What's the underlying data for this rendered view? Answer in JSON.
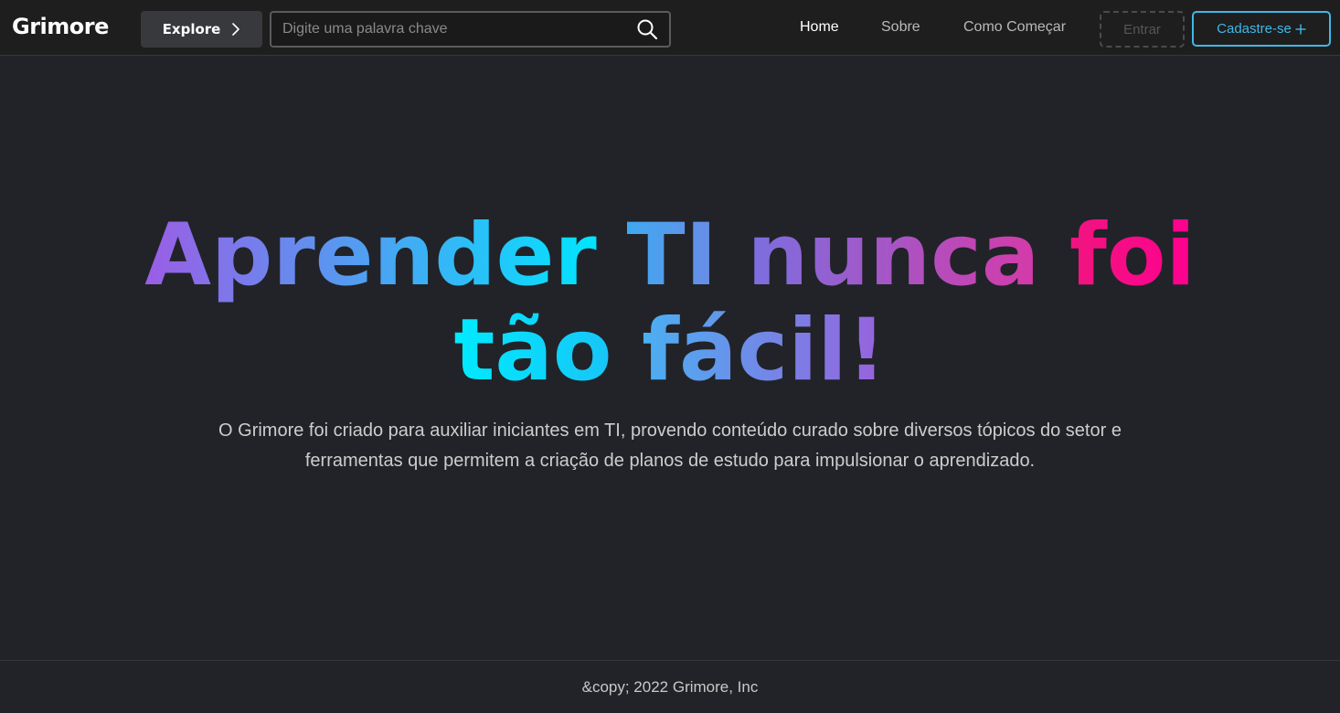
{
  "header": {
    "logo": "Grimore",
    "explore_label": "Explore",
    "search_placeholder": "Digite uma palavra chave",
    "nav": [
      {
        "label": "Home",
        "active": true
      },
      {
        "label": "Sobre",
        "active": false
      },
      {
        "label": "Como Começar",
        "active": false
      }
    ],
    "login_label": "Entrar",
    "signup_label": "Cadastre-se"
  },
  "hero": {
    "title_line1": [
      "Aprender",
      "TI",
      "nunca",
      "foi"
    ],
    "title_line2": [
      "tão",
      "fácil!"
    ],
    "description": "O Grimore foi criado para auxiliar iniciantes em TI, provendo conteúdo curado sobre diversos tópicos do setor e ferramentas que permitem a criação de planos de estudo para impulsionar o aprendizado."
  },
  "footer": {
    "text": "&copy; 2022 Grimore, Inc"
  },
  "colors": {
    "background": "#212328",
    "navbar": "#1e1e1e",
    "accent": "#3fb8e8",
    "gradient_purple": "#9b5de5",
    "gradient_cyan": "#00e5ff",
    "gradient_pink": "#ff0090"
  },
  "icons": {
    "explore": "chevron-right-icon",
    "search": "search-icon",
    "signup": "plus-icon"
  }
}
